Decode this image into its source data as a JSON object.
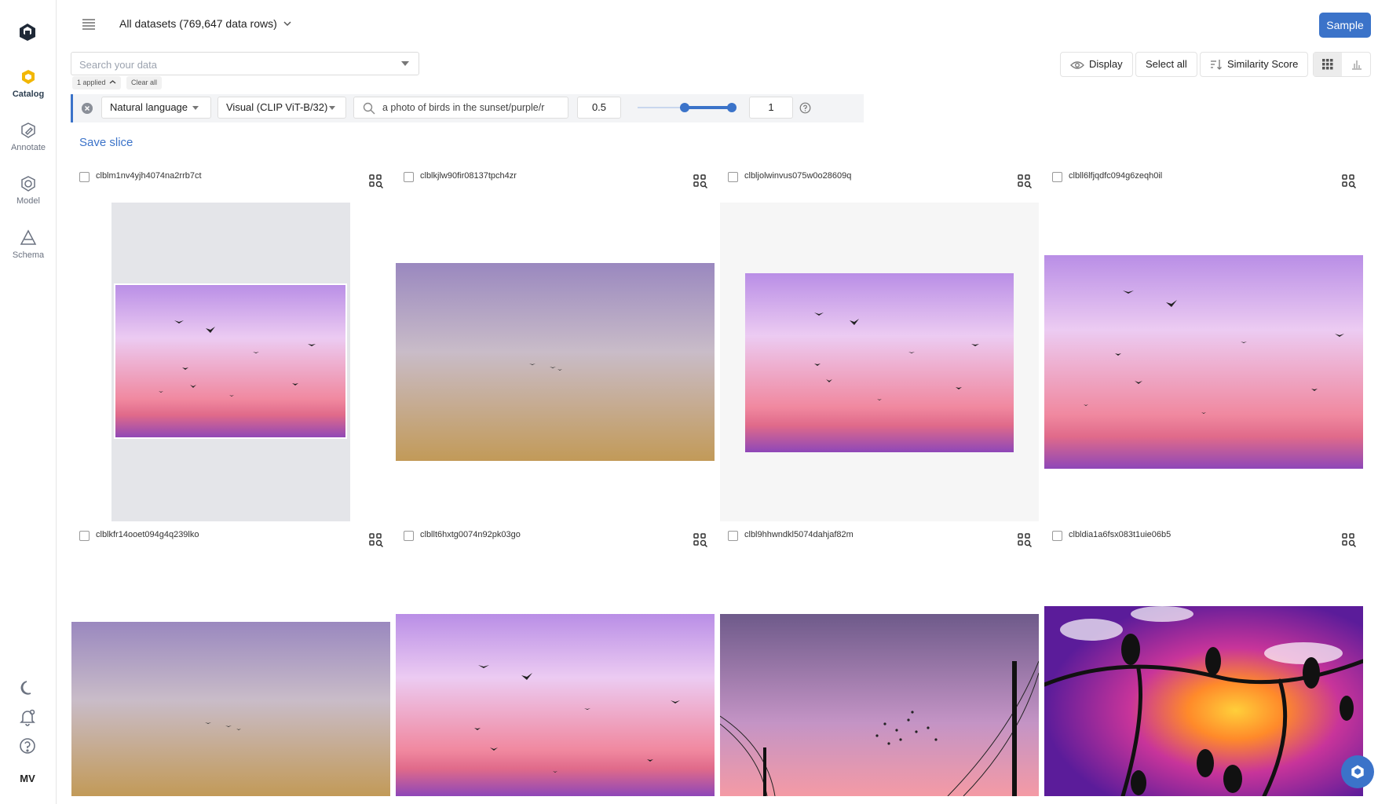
{
  "sidebar": {
    "items": [
      {
        "label": "Catalog"
      },
      {
        "label": "Annotate"
      },
      {
        "label": "Model"
      },
      {
        "label": "Schema"
      }
    ],
    "avatar": "MV"
  },
  "header": {
    "dataset_label": "All datasets (769,647 data rows)",
    "sample_label": "Sample"
  },
  "search": {
    "placeholder": "Search your data",
    "applied_label": "1 applied",
    "clear_label": "Clear all"
  },
  "toolbar": {
    "display_label": "Display",
    "select_all_label": "Select all",
    "sort_label": "Similarity Score"
  },
  "filter": {
    "mode": "Natural language",
    "model": "Visual (CLIP ViT-B/32)",
    "query": "a photo of birds in the sunset/purple/r",
    "min_value": "0.5",
    "max_value": "1",
    "slider_low": 0.5,
    "slider_high": 1
  },
  "save_slice_label": "Save slice",
  "grid": {
    "rows": [
      [
        {
          "id": "clblm1nv4yjh4074na2rrb7ct"
        },
        {
          "id": "clblkjlw90fir08137tpch4zr"
        },
        {
          "id": "clbljolwinvus075w0o28609q"
        },
        {
          "id": "clbll6lfjqdfc094g6zeqh0il"
        }
      ],
      [
        {
          "id": "clblkfr14ooet094g4q239lko"
        },
        {
          "id": "clbllt6hxtg0074n92pk03go"
        },
        {
          "id": "clbl9hhwndkl5074dahjaf82m"
        },
        {
          "id": "clbldia1a6fsx083t1uie06b5"
        }
      ]
    ]
  },
  "colors": {
    "accent": "#3b73c9"
  }
}
